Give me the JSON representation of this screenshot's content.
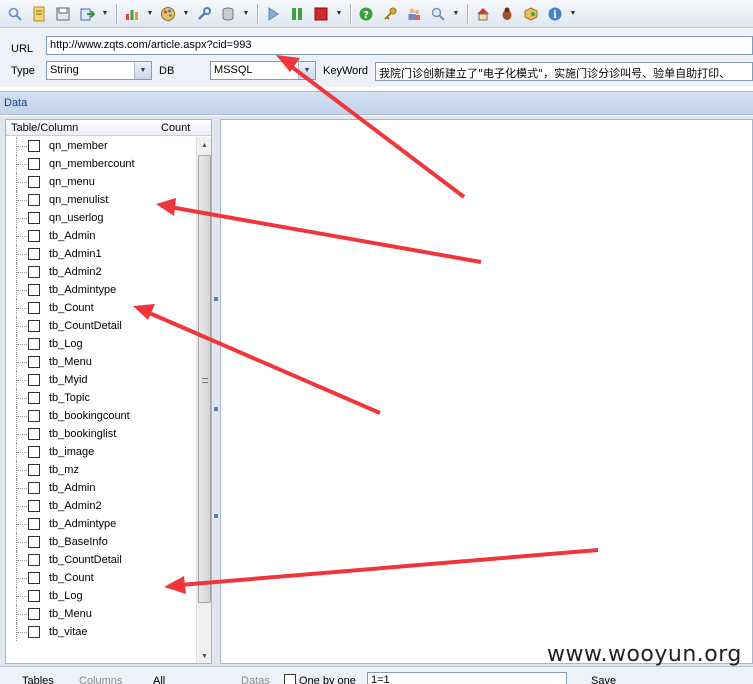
{
  "toolbar": {
    "icons": [
      "search-icon",
      "document-icon",
      "save-icon",
      "export-icon",
      "chart-icon",
      "palette-icon",
      "wrench-icon",
      "database-icon",
      "play-icon",
      "pause-icon",
      "stop-icon",
      "help-icon",
      "key-icon",
      "users-icon",
      "magnifier-icon",
      "home-icon",
      "bug-icon",
      "cube-icon",
      "info-icon"
    ]
  },
  "form": {
    "url_label": "URL",
    "url_value": "http://www.zqts.com/article.aspx?cid=993",
    "type_label": "Type",
    "type_value": "String",
    "db_label": "DB",
    "db_value": "MSSQL",
    "keyword_label": "KeyWord",
    "keyword_value": "我院门诊创新建立了\"电子化模式\"，实施门诊分诊叫号、验单自助打印、"
  },
  "data_header": "Data",
  "tree": {
    "col_table": "Table/Column",
    "col_count": "Count",
    "items": [
      "qn_member",
      "qn_membercount",
      "qn_menu",
      "qn_menulist",
      "qn_userlog",
      "tb_Admin",
      "tb_Admin1",
      "tb_Admin2",
      "tb_Admintype",
      "tb_Count",
      "tb_CountDetail",
      "tb_Log",
      "tb_Menu",
      "tb_Myid",
      "tb_Topic",
      "tb_bookingcount",
      "tb_bookinglist",
      "tb_image",
      "tb_mz",
      "tb_Admin",
      "tb_Admin2",
      "tb_Admintype",
      "tb_BaseInfo",
      "tb_CountDetail",
      "tb_Count",
      "tb_Log",
      "tb_Menu",
      "tb_vitae"
    ]
  },
  "bottom": {
    "tables": "Tables",
    "columns": "Columns",
    "all": "All",
    "datas": "Datas",
    "one_by_one": "One by one",
    "where_value": "1=1",
    "save": "Save"
  },
  "watermark": "www.wooyun.org",
  "colors": {
    "arrow": "#f0363a",
    "header_text": "#15428b"
  }
}
